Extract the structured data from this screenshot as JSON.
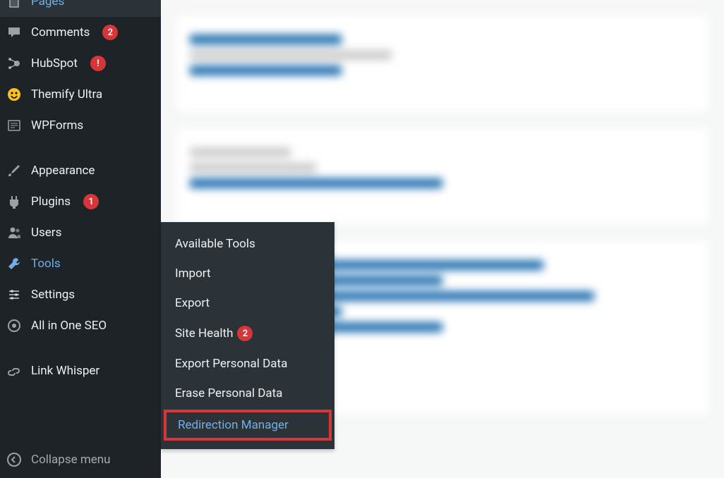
{
  "sidebar": {
    "items": [
      {
        "label": "Pages",
        "icon": "pages",
        "badge": null,
        "active": false,
        "partial": true
      },
      {
        "label": "Comments",
        "icon": "comment",
        "badge": "2",
        "active": false
      },
      {
        "label": "HubSpot",
        "icon": "hubspot",
        "badge": "!",
        "active": false
      },
      {
        "label": "Themify Ultra",
        "icon": "themify",
        "badge": null,
        "active": false
      },
      {
        "label": "WPForms",
        "icon": "wpforms",
        "badge": null,
        "active": false
      },
      {
        "separator": true
      },
      {
        "label": "Appearance",
        "icon": "brush",
        "badge": null,
        "active": false
      },
      {
        "label": "Plugins",
        "icon": "plugin",
        "badge": "1",
        "active": false
      },
      {
        "label": "Users",
        "icon": "users",
        "badge": null,
        "active": false
      },
      {
        "label": "Tools",
        "icon": "wrench",
        "badge": null,
        "active": true
      },
      {
        "label": "Settings",
        "icon": "settings",
        "badge": null,
        "active": false
      },
      {
        "label": "All in One SEO",
        "icon": "seo",
        "badge": null,
        "active": false
      },
      {
        "separator": true
      },
      {
        "label": "Link Whisper",
        "icon": "linkwhisper",
        "badge": null,
        "active": false
      }
    ],
    "collapse_label": "Collapse menu"
  },
  "submenu": {
    "items": [
      {
        "label": "Available Tools",
        "badge": null,
        "highlighted": false
      },
      {
        "label": "Import",
        "badge": null,
        "highlighted": false
      },
      {
        "label": "Export",
        "badge": null,
        "highlighted": false
      },
      {
        "label": "Site Health",
        "badge": "2",
        "highlighted": false
      },
      {
        "label": "Export Personal Data",
        "badge": null,
        "highlighted": false
      },
      {
        "label": "Erase Personal Data",
        "badge": null,
        "highlighted": false
      },
      {
        "label": "Redirection Manager",
        "badge": null,
        "highlighted": true
      }
    ]
  }
}
